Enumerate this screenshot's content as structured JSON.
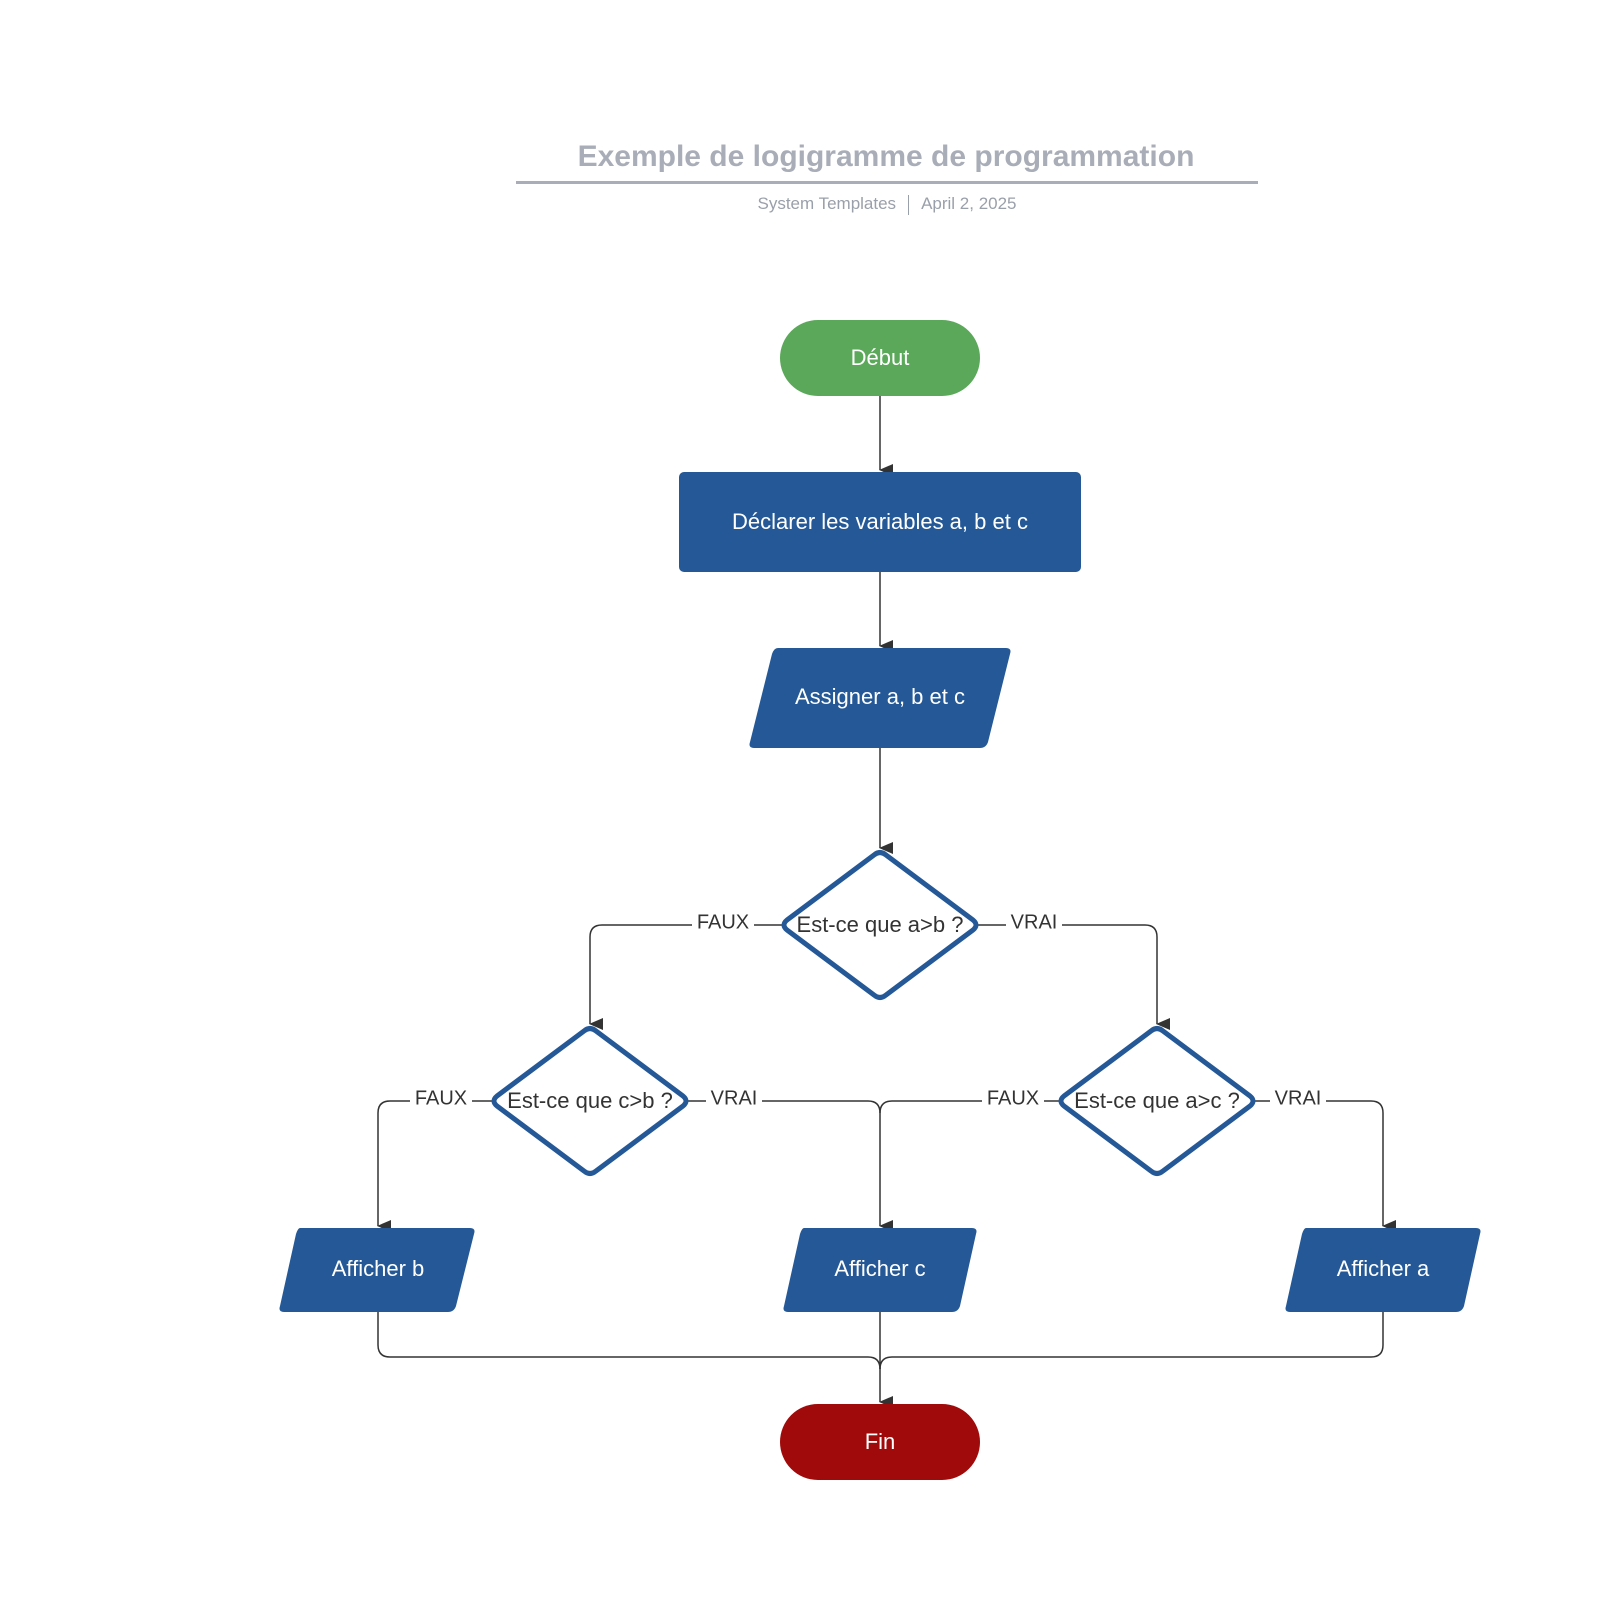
{
  "header": {
    "title": "Exemple de logigramme de programmation",
    "author": "System Templates",
    "date": "April 2, 2025"
  },
  "colors": {
    "start": "#5ba85a",
    "end": "#a00a0a",
    "process": "#245896",
    "decision_stroke": "#245896",
    "edge": "#333333",
    "title": "#a8adb7"
  },
  "nodes": {
    "start": {
      "label": "Début",
      "shape": "terminator"
    },
    "declare": {
      "label": "Déclarer les variables a, b et c",
      "shape": "process"
    },
    "assign": {
      "label": "Assigner a, b et c",
      "shape": "input-output"
    },
    "decision_ab": {
      "label": "Est-ce que a>b ?",
      "shape": "decision"
    },
    "decision_cb": {
      "label": "Est-ce que c>b ?",
      "shape": "decision"
    },
    "decision_ac": {
      "label": "Est-ce que a>c ?",
      "shape": "decision"
    },
    "show_b": {
      "label": "Afficher b",
      "shape": "input-output"
    },
    "show_c": {
      "label": "Afficher c",
      "shape": "input-output"
    },
    "show_a": {
      "label": "Afficher a",
      "shape": "input-output"
    },
    "end": {
      "label": "Fin",
      "shape": "terminator"
    }
  },
  "edges": [
    {
      "from": "start",
      "to": "declare",
      "label": ""
    },
    {
      "from": "declare",
      "to": "assign",
      "label": ""
    },
    {
      "from": "assign",
      "to": "decision_ab",
      "label": ""
    },
    {
      "from": "decision_ab",
      "to": "decision_cb",
      "label": "FAUX"
    },
    {
      "from": "decision_ab",
      "to": "decision_ac",
      "label": "VRAI"
    },
    {
      "from": "decision_cb",
      "to": "show_b",
      "label": "FAUX"
    },
    {
      "from": "decision_cb",
      "to": "show_c",
      "label": "VRAI"
    },
    {
      "from": "decision_ac",
      "to": "show_c",
      "label": "FAUX"
    },
    {
      "from": "decision_ac",
      "to": "show_a",
      "label": "VRAI"
    },
    {
      "from": "show_b",
      "to": "end",
      "label": ""
    },
    {
      "from": "show_c",
      "to": "end",
      "label": ""
    },
    {
      "from": "show_a",
      "to": "end",
      "label": ""
    }
  ],
  "edge_labels": {
    "ab_false": "FAUX",
    "ab_true": "VRAI",
    "cb_false": "FAUX",
    "cb_true": "VRAI",
    "ac_false": "FAUX",
    "ac_true": "VRAI"
  }
}
